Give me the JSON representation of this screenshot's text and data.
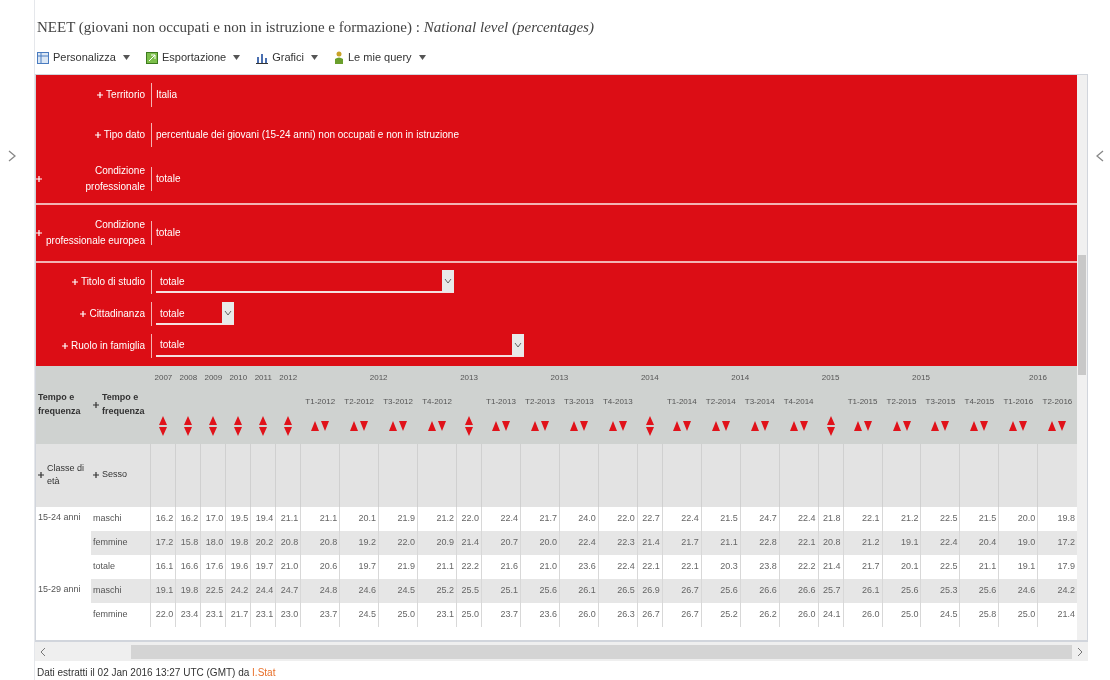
{
  "title": "NEET (giovani non occupati e non in istruzione e formazione) : *National level (percentages)*",
  "toolbar": [
    {
      "label": "Personalizza"
    },
    {
      "label": "Esportazione"
    },
    {
      "label": "Grafici"
    },
    {
      "label": "Le mie query"
    }
  ],
  "filter_sections": [
    {
      "filters": [
        {
          "label": "Territorio",
          "value": "Italia",
          "kind": "text"
        },
        {
          "label": "Tipo dato",
          "value": "percentuale dei giovani (15-24 anni) non occupati e non in istruzione",
          "kind": "text"
        },
        {
          "label": "Condizione professionale",
          "value": "totale",
          "kind": "text"
        }
      ]
    },
    {
      "filters": [
        {
          "label": "Condizione professionale europea",
          "value": "totale",
          "kind": "text"
        }
      ]
    },
    {
      "filters": [
        {
          "label": "Titolo di studio",
          "value": "totale",
          "kind": "select"
        },
        {
          "label": "Cittadinanza",
          "value": "totale",
          "kind": "select"
        },
        {
          "label": "Ruolo in famiglia",
          "value": "totale",
          "kind": "select"
        }
      ]
    }
  ],
  "table": {
    "header_left": "Tempo e frequenza",
    "header_right": "Tempo e frequenza",
    "row_dim_1": "Classe di età",
    "row_dim_2": "Sesso",
    "column_groups": [
      {
        "year": "2007",
        "columns": [
          {
            "kind": "annual"
          }
        ]
      },
      {
        "year": "2008",
        "columns": [
          {
            "kind": "annual"
          }
        ]
      },
      {
        "year": "2009",
        "columns": [
          {
            "kind": "annual"
          }
        ]
      },
      {
        "year": "2010",
        "columns": [
          {
            "kind": "annual"
          }
        ]
      },
      {
        "year": "2011",
        "columns": [
          {
            "kind": "annual"
          }
        ]
      },
      {
        "year": "2012",
        "columns": [
          {
            "kind": "annual"
          }
        ]
      },
      {
        "year": "2012",
        "columns": [
          {
            "kind": "quarter",
            "label": "T1-2012"
          },
          {
            "kind": "quarter",
            "label": "T2-2012"
          },
          {
            "kind": "quarter",
            "label": "T3-2012"
          },
          {
            "kind": "quarter",
            "label": "T4-2012"
          }
        ]
      },
      {
        "year": "2013",
        "columns": [
          {
            "kind": "annual"
          }
        ]
      },
      {
        "year": "2013",
        "columns": [
          {
            "kind": "quarter",
            "label": "T1-2013"
          },
          {
            "kind": "quarter",
            "label": "T2-2013"
          },
          {
            "kind": "quarter",
            "label": "T3-2013"
          },
          {
            "kind": "quarter",
            "label": "T4-2013"
          }
        ]
      },
      {
        "year": "2014",
        "columns": [
          {
            "kind": "annual"
          }
        ]
      },
      {
        "year": "2014",
        "columns": [
          {
            "kind": "quarter",
            "label": "T1-2014"
          },
          {
            "kind": "quarter",
            "label": "T2-2014"
          },
          {
            "kind": "quarter",
            "label": "T3-2014"
          },
          {
            "kind": "quarter",
            "label": "T4-2014"
          }
        ]
      },
      {
        "year": "2015",
        "columns": [
          {
            "kind": "annual"
          }
        ]
      },
      {
        "year": "2015",
        "columns": [
          {
            "kind": "quarter",
            "label": "T1-2015"
          },
          {
            "kind": "quarter",
            "label": "T2-2015"
          },
          {
            "kind": "quarter",
            "label": "T3-2015"
          },
          {
            "kind": "quarter",
            "label": "T4-2015"
          }
        ]
      },
      {
        "year": "2016",
        "columns": [
          {
            "kind": "quarter",
            "label": "T1-2016"
          },
          {
            "kind": "quarter",
            "label": "T2-2016"
          }
        ]
      }
    ],
    "groups": [
      {
        "label": "15-24 anni",
        "rows": [
          {
            "label": "maschi",
            "values": [
              "16.2",
              "16.2",
              "17.0",
              "19.5",
              "19.4",
              "21.1",
              "21.1",
              "20.1",
              "21.9",
              "21.2",
              "22.0",
              "22.4",
              "21.7",
              "24.0",
              "22.0",
              "22.7",
              "22.4",
              "21.5",
              "24.7",
              "22.4",
              "21.8",
              "22.1",
              "21.2",
              "22.5",
              "21.5",
              "20.0",
              "19.8"
            ]
          },
          {
            "label": "femmine",
            "values": [
              "17.2",
              "15.8",
              "18.0",
              "19.8",
              "20.2",
              "20.8",
              "20.8",
              "19.2",
              "22.0",
              "20.9",
              "21.4",
              "20.7",
              "20.0",
              "22.4",
              "22.3",
              "21.4",
              "21.7",
              "21.1",
              "22.8",
              "22.1",
              "20.8",
              "21.2",
              "19.1",
              "22.4",
              "20.4",
              "19.0",
              "17.2"
            ]
          },
          {
            "label": "totale",
            "values": [
              "16.1",
              "16.6",
              "17.6",
              "19.6",
              "19.7",
              "21.0",
              "20.6",
              "19.7",
              "21.9",
              "21.1",
              "22.2",
              "21.6",
              "21.0",
              "23.6",
              "22.4",
              "22.1",
              "22.1",
              "20.3",
              "23.8",
              "22.2",
              "21.4",
              "21.7",
              "20.1",
              "22.5",
              "21.1",
              "19.1",
              "17.9"
            ]
          }
        ]
      },
      {
        "label": "15-29 anni",
        "rows": [
          {
            "label": "maschi",
            "values": [
              "19.1",
              "19.8",
              "22.5",
              "24.2",
              "24.4",
              "24.7",
              "24.8",
              "24.6",
              "24.5",
              "25.2",
              "25.5",
              "25.1",
              "25.6",
              "26.1",
              "26.5",
              "26.9",
              "26.7",
              "25.6",
              "26.6",
              "26.6",
              "25.7",
              "26.1",
              "25.6",
              "25.3",
              "25.6",
              "24.6",
              "24.2"
            ]
          },
          {
            "label": "femmine",
            "values": [
              "22.0",
              "23.4",
              "23.1",
              "21.7",
              "23.1",
              "23.0",
              "23.7",
              "24.5",
              "25.0",
              "23.1",
              "25.0",
              "23.7",
              "23.6",
              "26.0",
              "26.3",
              "26.7",
              "26.7",
              "25.2",
              "26.2",
              "26.0",
              "24.1",
              "26.0",
              "25.0",
              "24.5",
              "25.8",
              "25.0",
              "21.4"
            ]
          }
        ]
      }
    ]
  },
  "footer": {
    "text": "Dati estratti il 02 Jan 2016 13:27 UTC (GMT) da ",
    "link": "I.Stat"
  }
}
